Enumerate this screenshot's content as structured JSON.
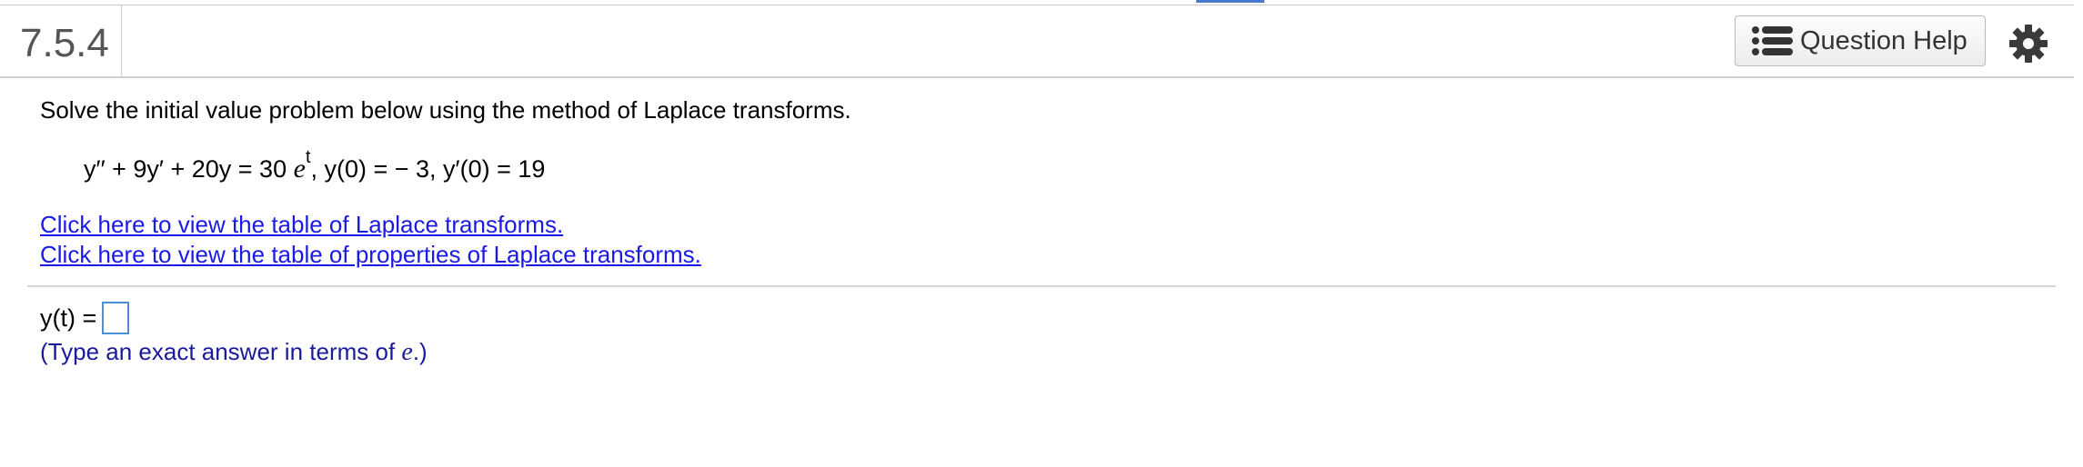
{
  "header": {
    "question_number": "7.5.4",
    "help_label": "Question Help",
    "help_icon": "list-icon",
    "settings_icon": "gear-icon"
  },
  "problem": {
    "prompt": "Solve the initial value problem below using the method of Laplace transforms.",
    "equation": {
      "lhs": "y′′ + 9y′ + 20y = 30",
      "exp_base": "e",
      "exp_power": "t",
      "conditions": ", y(0) = − 3, y′(0) = 19"
    },
    "links": [
      "Click here to view the table of Laplace transforms.",
      "Click here to view the table of properties of Laplace transforms."
    ]
  },
  "answer": {
    "label": "y(t) =",
    "value": "",
    "hint_prefix": "(Type an exact answer in terms of ",
    "hint_var": "e",
    "hint_suffix": ".)"
  },
  "colors": {
    "link": "#1a1ae6",
    "hint": "#1a1a9a",
    "input_border": "#4a90d9"
  }
}
